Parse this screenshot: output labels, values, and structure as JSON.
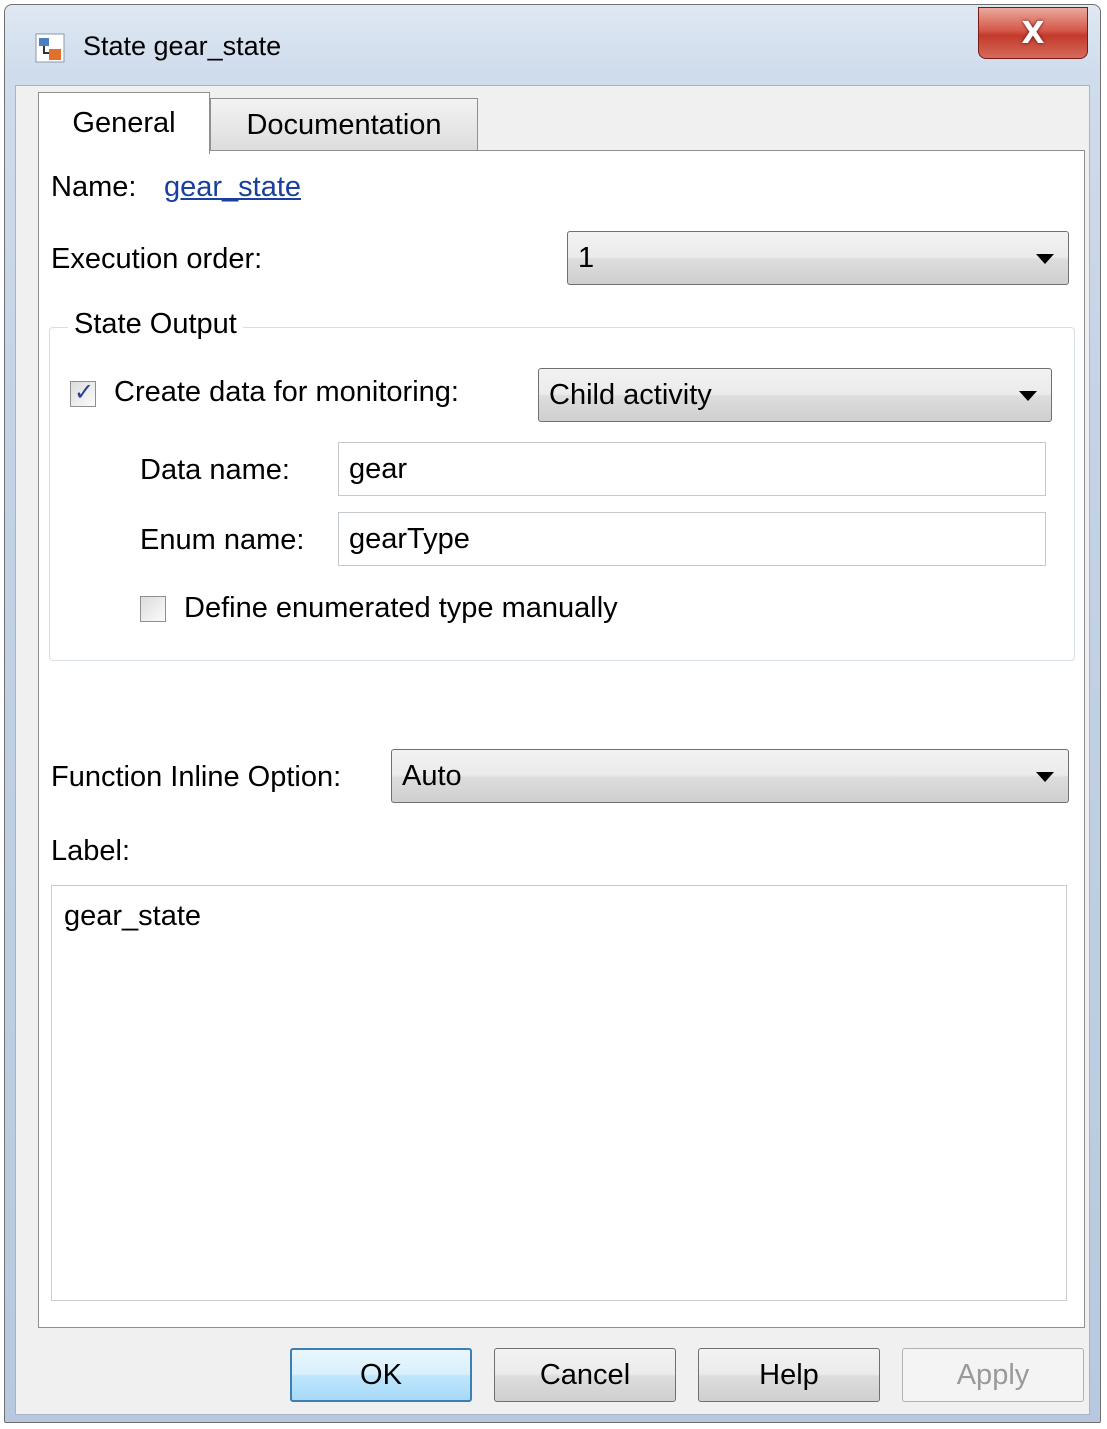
{
  "window": {
    "title": "State gear_state",
    "close_label": "X"
  },
  "tabs": [
    {
      "label": "General",
      "active": true
    },
    {
      "label": "Documentation",
      "active": false
    }
  ],
  "general": {
    "name_label": "Name:",
    "name_value": "gear_state",
    "execution_order_label": "Execution order:",
    "execution_order_value": "1",
    "state_output": {
      "legend": "State Output",
      "create_data_checked": true,
      "create_data_label": "Create data for monitoring:",
      "monitoring_mode_value": "Child activity",
      "data_name_label": "Data name:",
      "data_name_value": "gear",
      "enum_name_label": "Enum name:",
      "enum_name_value": "gearType",
      "define_enum_checked": false,
      "define_enum_label": "Define enumerated type manually"
    },
    "function_inline_label": "Function Inline Option:",
    "function_inline_value": "Auto",
    "label_label": "Label:",
    "label_value": "gear_state"
  },
  "buttons": {
    "ok": "OK",
    "cancel": "Cancel",
    "help": "Help",
    "apply": "Apply"
  },
  "colors": {
    "link": "#1a3f9c",
    "close_button": "#c23a2c",
    "default_button_border": "#3c7fb1"
  },
  "icons": {
    "title": "stateflow-state-icon",
    "dropdown": "chevron-down-icon",
    "checkmark": "checkmark-icon"
  }
}
